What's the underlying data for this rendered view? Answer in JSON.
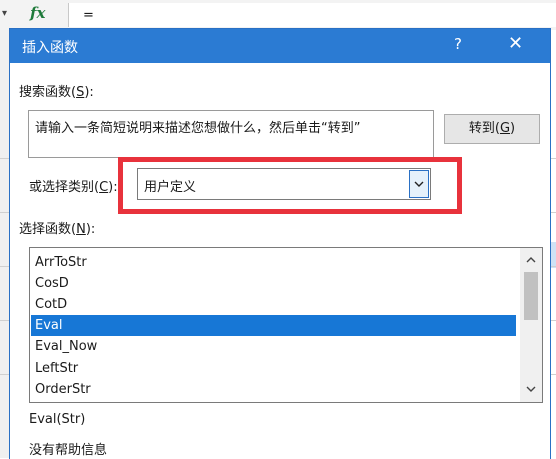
{
  "excel": {
    "fx_symbol": "fx",
    "formula_value": "="
  },
  "dialog": {
    "title": "插入函数",
    "help_label": "?",
    "close_label": "✕",
    "search_label": "搜索函数(",
    "search_key": "S",
    "search_label_end": "):",
    "search_value": "请输入一条简短说明来描述您想做什么，然后单击“转到”",
    "goto_label": "转到(",
    "goto_key": "G",
    "goto_label_end": ")",
    "category_label": "或选择类别(",
    "category_key": "C",
    "category_label_end": "):",
    "category_value": "用户定义",
    "function_label": "选择函数(",
    "function_key": "N",
    "function_label_end": "):",
    "functions": [
      "ArrToStr",
      "CosD",
      "CotD",
      "Eval",
      "Eval_Now",
      "LeftStr",
      "OrderStr"
    ],
    "selected_function": "Eval",
    "signature": "Eval(Str)",
    "help_text": "没有帮助信息"
  },
  "colors": {
    "titlebar": "#2b7bd3",
    "selection": "#1777d6",
    "highlight_box": "#e8323c"
  }
}
